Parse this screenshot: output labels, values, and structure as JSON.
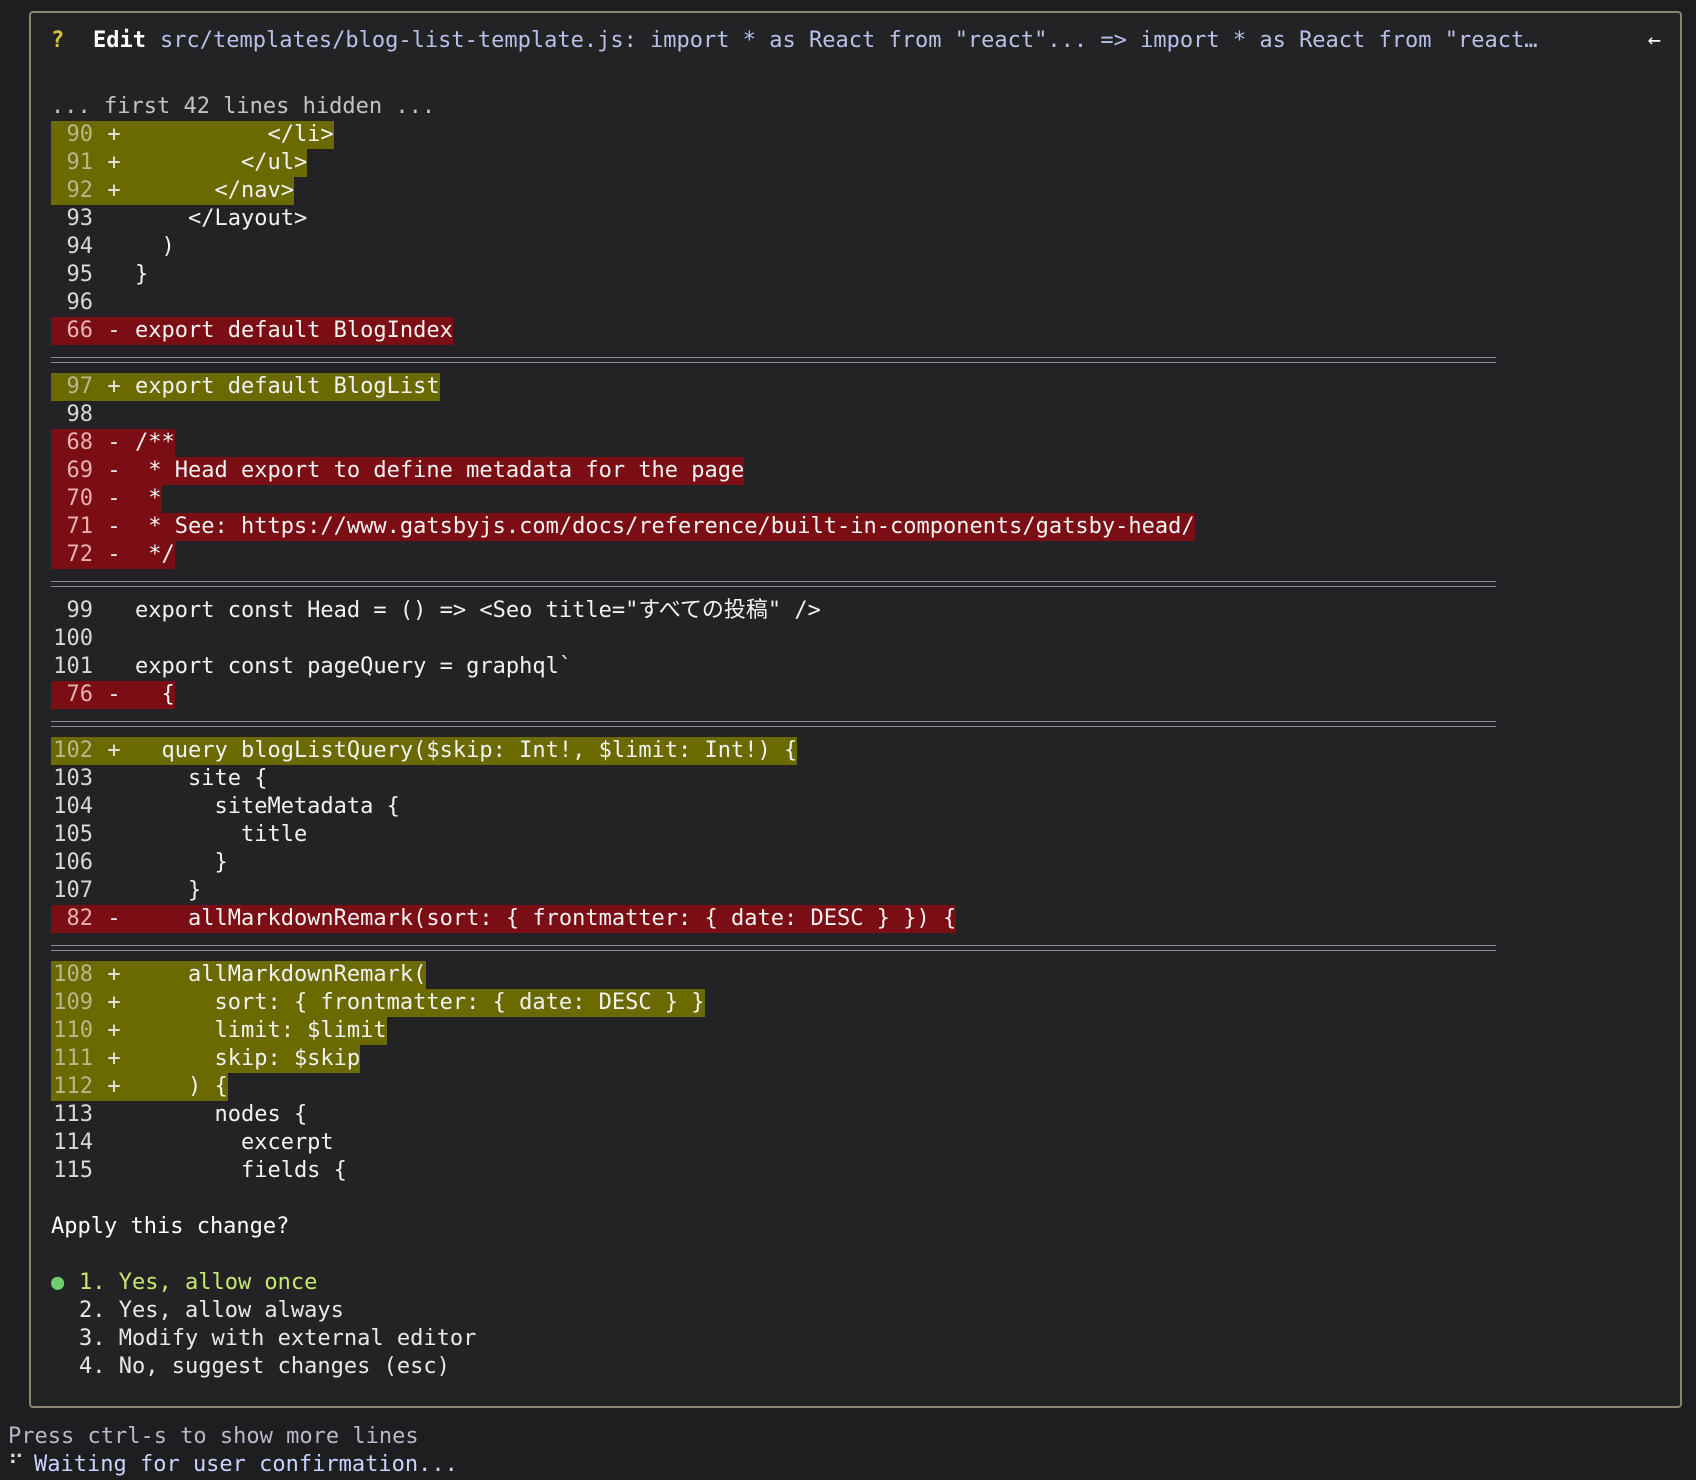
{
  "header": {
    "question_mark": "?",
    "tool": "Edit",
    "description": "src/templates/blog-list-template.js: import * as React from \"react\"... => import * as React from \"react…",
    "arrow_icon": "←"
  },
  "hidden_note": "... first 42 lines hidden ...",
  "diff": {
    "lines": [
      {
        "kind": "add",
        "num": "90",
        "marker": "+",
        "code": "          </li>"
      },
      {
        "kind": "add",
        "num": "91",
        "marker": "+",
        "code": "        </ul>"
      },
      {
        "kind": "add",
        "num": "92",
        "marker": "+",
        "code": "      </nav>"
      },
      {
        "kind": "ctx",
        "num": "93",
        "marker": " ",
        "code": "    </Layout>"
      },
      {
        "kind": "ctx",
        "num": "94",
        "marker": " ",
        "code": "  )"
      },
      {
        "kind": "ctx",
        "num": "95",
        "marker": " ",
        "code": "}"
      },
      {
        "kind": "ctx",
        "num": "96",
        "marker": " ",
        "code": ""
      },
      {
        "kind": "del",
        "num": "66",
        "marker": "-",
        "code": "export default BlogIndex"
      },
      {
        "kind": "sep"
      },
      {
        "kind": "add",
        "num": "97",
        "marker": "+",
        "code": "export default BlogList"
      },
      {
        "kind": "ctx",
        "num": "98",
        "marker": " ",
        "code": ""
      },
      {
        "kind": "del",
        "num": "68",
        "marker": "-",
        "code": "/**"
      },
      {
        "kind": "del",
        "num": "69",
        "marker": "-",
        "code": " * Head export to define metadata for the page"
      },
      {
        "kind": "del",
        "num": "70",
        "marker": "-",
        "code": " *"
      },
      {
        "kind": "del",
        "num": "71",
        "marker": "-",
        "code": " * See: https://www.gatsbyjs.com/docs/reference/built-in-components/gatsby-head/"
      },
      {
        "kind": "del",
        "num": "72",
        "marker": "-",
        "code": " */"
      },
      {
        "kind": "sep"
      },
      {
        "kind": "ctx",
        "num": "99",
        "marker": " ",
        "code": "export const Head = () => <Seo title=\"すべての投稿\" />"
      },
      {
        "kind": "ctx",
        "num": "100",
        "marker": " ",
        "code": ""
      },
      {
        "kind": "ctx",
        "num": "101",
        "marker": " ",
        "code": "export const pageQuery = graphql`"
      },
      {
        "kind": "del",
        "num": "76",
        "marker": "-",
        "code": "  {"
      },
      {
        "kind": "sep"
      },
      {
        "kind": "add",
        "num": "102",
        "marker": "+",
        "code": "  query blogListQuery($skip: Int!, $limit: Int!) {"
      },
      {
        "kind": "ctx",
        "num": "103",
        "marker": " ",
        "code": "    site {"
      },
      {
        "kind": "ctx",
        "num": "104",
        "marker": " ",
        "code": "      siteMetadata {"
      },
      {
        "kind": "ctx",
        "num": "105",
        "marker": " ",
        "code": "        title"
      },
      {
        "kind": "ctx",
        "num": "106",
        "marker": " ",
        "code": "      }"
      },
      {
        "kind": "ctx",
        "num": "107",
        "marker": " ",
        "code": "    }"
      },
      {
        "kind": "del",
        "num": "82",
        "marker": "-",
        "code": "    allMarkdownRemark(sort: { frontmatter: { date: DESC } }) {"
      },
      {
        "kind": "sep"
      },
      {
        "kind": "add",
        "num": "108",
        "marker": "+",
        "code": "    allMarkdownRemark("
      },
      {
        "kind": "add",
        "num": "109",
        "marker": "+",
        "code": "      sort: { frontmatter: { date: DESC } }"
      },
      {
        "kind": "add",
        "num": "110",
        "marker": "+",
        "code": "      limit: $limit"
      },
      {
        "kind": "add",
        "num": "111",
        "marker": "+",
        "code": "      skip: $skip"
      },
      {
        "kind": "add",
        "num": "112",
        "marker": "+",
        "code": "    ) {"
      },
      {
        "kind": "ctx",
        "num": "113",
        "marker": " ",
        "code": "      nodes {"
      },
      {
        "kind": "ctx",
        "num": "114",
        "marker": " ",
        "code": "        excerpt"
      },
      {
        "kind": "ctx",
        "num": "115",
        "marker": " ",
        "code": "        fields {"
      }
    ]
  },
  "prompt": "Apply this change?",
  "options": [
    {
      "label": "1. Yes, allow once",
      "selected": true
    },
    {
      "label": "2. Yes, allow always",
      "selected": false
    },
    {
      "label": "3. Modify with external editor",
      "selected": false
    },
    {
      "label": "4. No, suggest changes (esc)",
      "selected": false
    }
  ],
  "selected_marker": "●",
  "footer": {
    "hint": "Press ctrl-s to show more lines",
    "spinner_icon": "⠋",
    "status": "Waiting for user confirmation..."
  },
  "colors": {
    "added_bg": "#6a6a00",
    "removed_bg": "#7a0e14",
    "border": "#8c8670",
    "accent_yellow": "#d8c13a",
    "selected_green": "#6fd06f"
  }
}
